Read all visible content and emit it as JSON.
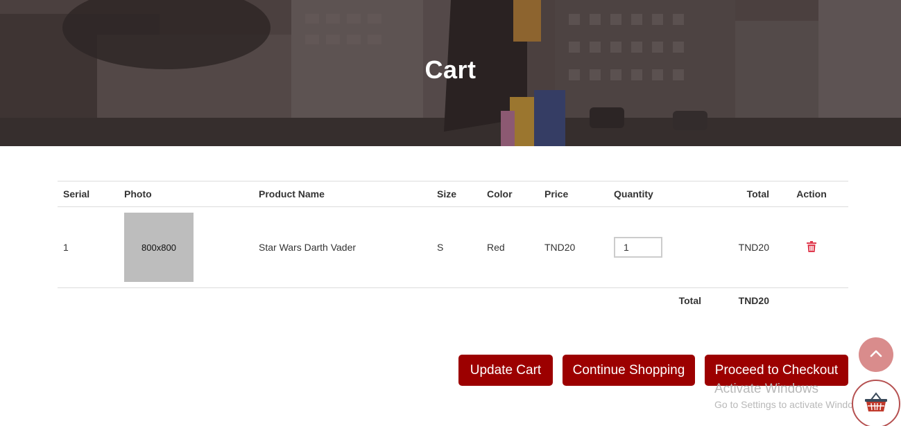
{
  "banner": {
    "title": "Cart"
  },
  "table": {
    "headers": {
      "serial": "Serial",
      "photo": "Photo",
      "product_name": "Product Name",
      "size": "Size",
      "color": "Color",
      "price": "Price",
      "quantity": "Quantity",
      "total": "Total",
      "action": "Action"
    },
    "rows": [
      {
        "serial": "1",
        "photo_placeholder": "800x800",
        "product_name": "Star Wars Darth Vader",
        "size": "S",
        "color": "Red",
        "price": "TND20",
        "quantity": "1",
        "total": "TND20",
        "action_icon": "trash-icon"
      }
    ],
    "summary": {
      "label": "Total",
      "value": "TND20"
    }
  },
  "buttons": {
    "update_cart": "Update Cart",
    "continue_shopping": "Continue Shopping",
    "proceed_checkout": "Proceed to Checkout"
  },
  "watermark": {
    "title": "Activate Windows",
    "subtitle": "Go to Settings to activate Windows."
  },
  "floating": {
    "scroll_top_icon": "chevron-up-icon",
    "cart_icon": "shopping-basket-icon"
  },
  "colors": {
    "primary": "#9c0000",
    "trash": "#e03a4e",
    "scroll_top_bg": "#d98c8c"
  }
}
